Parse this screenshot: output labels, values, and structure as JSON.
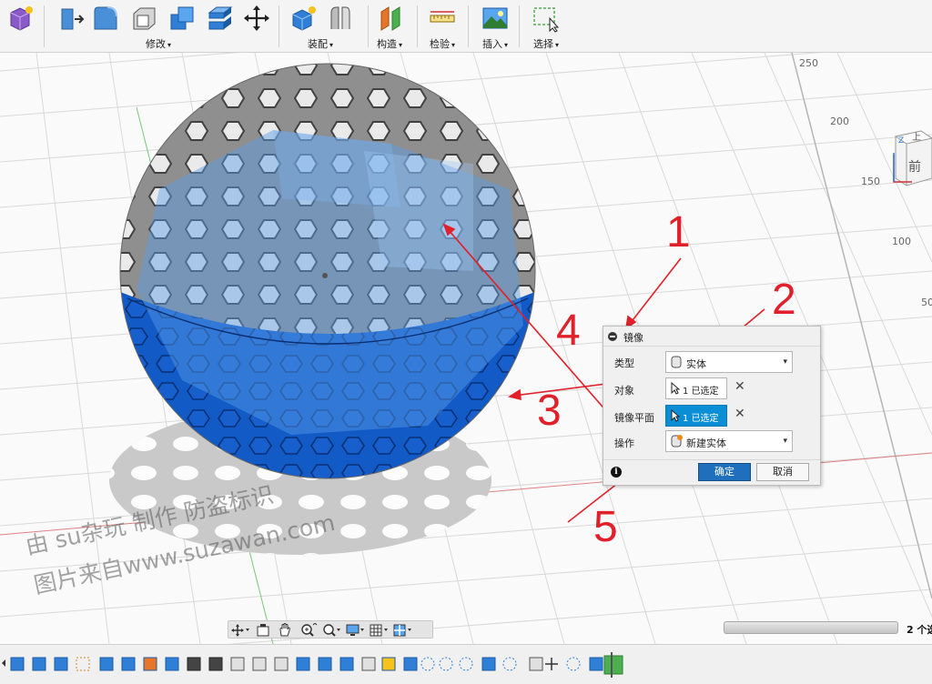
{
  "toolbar": {
    "groups": [
      {
        "label": "修改",
        "caret": "▾"
      },
      {
        "label": "装配",
        "caret": "▾"
      },
      {
        "label": "构造",
        "caret": "▾"
      },
      {
        "label": "检验",
        "caret": "▾"
      },
      {
        "label": "插入",
        "caret": "▾"
      },
      {
        "label": "选择",
        "caret": "▾"
      }
    ],
    "icons": [
      "create-solid-icon",
      "press-pull-icon",
      "fillet-icon",
      "shell-icon",
      "combine-icon",
      "split-icon",
      "move-icon",
      "new-component-icon",
      "joint-icon",
      "offset-plane-icon",
      "measure-icon",
      "insert-image-icon",
      "select-window-icon"
    ]
  },
  "viewport": {
    "grid_ticks": [
      "250",
      "200",
      "150",
      "100",
      "50"
    ],
    "viewcube_labels": {
      "top": "上",
      "front": "前",
      "axis_z": "Z"
    }
  },
  "dialog": {
    "title": "镜像",
    "type_label": "类型",
    "type_value": "实体",
    "objects_label": "对象",
    "objects_value": "1 已选定",
    "plane_label": "镜像平面",
    "plane_value": "1 已选定",
    "operation_label": "操作",
    "operation_value": "新建实体",
    "ok_label": "确定",
    "cancel_label": "取消",
    "info_glyph": "i",
    "clear_glyph": "✕",
    "dropdown_glyph": "▾"
  },
  "annotations": [
    "1",
    "2",
    "3",
    "4",
    "5"
  ],
  "watermark": {
    "line1": "由 su杂玩 制作 防盗标识",
    "line2": "图片来自www.suzawan.com"
  },
  "status": {
    "count_text": "2 个选"
  },
  "colors": {
    "accent_blue": "#1f6fbd",
    "selection_blue": "#0a8fd6",
    "body_blue": "#1565d8",
    "annotation_red": "#e0202a"
  }
}
